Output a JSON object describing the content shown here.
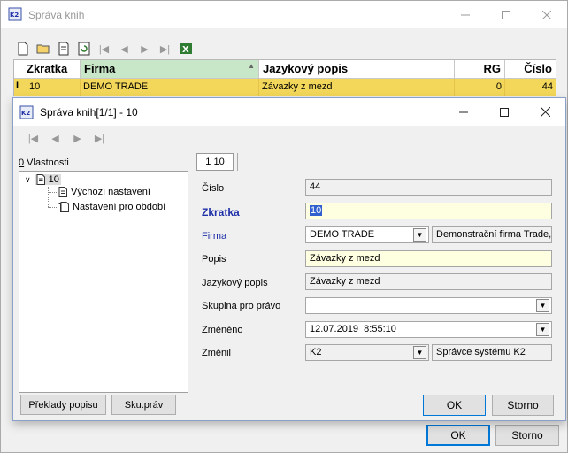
{
  "outer": {
    "title": "Správa knih",
    "grid": {
      "columns": [
        "Zkratka",
        "Firma",
        "Jazykový popis",
        "RG",
        "Číslo"
      ],
      "row": {
        "marker": "I",
        "zkratka": "10",
        "firma": "DEMO TRADE",
        "popis": "Závazky z mezd",
        "rg": "0",
        "cislo": "44"
      }
    },
    "ok": "OK",
    "storno": "Storno"
  },
  "dialog": {
    "title": "Správa knih[1/1] - 10",
    "props_hotkey": "0",
    "props_rest": " Vlastnosti",
    "tree": {
      "root": "10",
      "child1": "Výchozí nastavení",
      "child2": "Nastavení pro období"
    },
    "tab": "1 10",
    "fields": {
      "cislo_label": "Číslo",
      "cislo_value": "44",
      "zkratka_label": "Zkratka",
      "zkratka_value": "10",
      "firma_label": "Firma",
      "firma_value": "DEMO TRADE",
      "firma_desc": "Demonstrační firma Trade,",
      "popis_label": "Popis",
      "popis_value": "Závazky z mezd",
      "jazpopis_label": "Jazykový popis",
      "jazpopis_value": "Závazky z mezd",
      "skupina_label": "Skupina pro právo",
      "skupina_value": "",
      "zmeneno_label": "Změněno",
      "zmeneno_value": "12.07.2019  8:55:10",
      "zmenil_label": "Změnil",
      "zmenil_value": "K2",
      "zmenil_desc": "Správce systému K2"
    },
    "buttons": {
      "preklady": "Překlady popisu",
      "sku": "Sku.práv",
      "ok": "OK",
      "storno": "Storno"
    }
  }
}
